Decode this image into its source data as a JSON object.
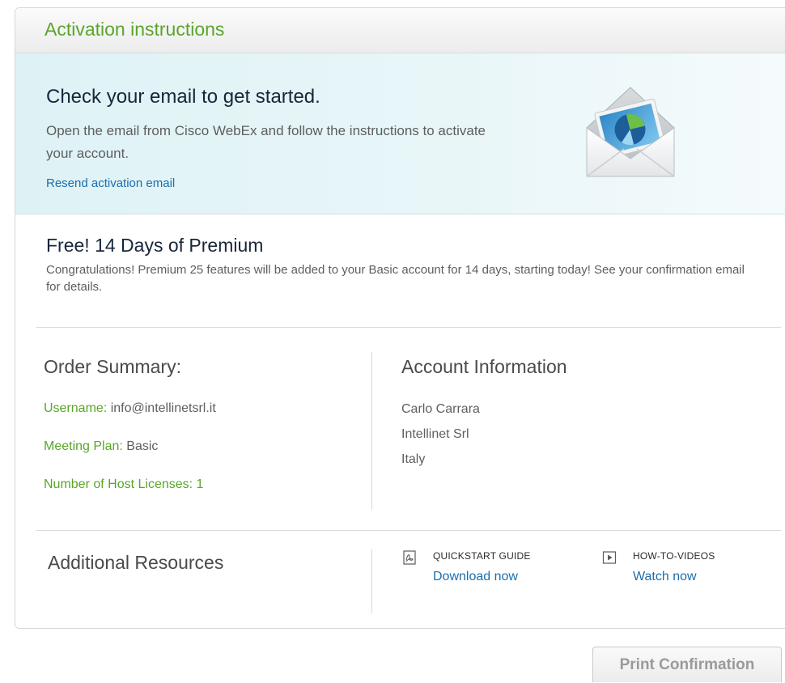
{
  "panel": {
    "title": "Activation instructions"
  },
  "activation": {
    "headline": "Check your email to get started.",
    "description": "Open the email from Cisco WebEx and follow the instructions to activate your account.",
    "resend_link": "Resend activation email",
    "icon": "envelope-icon"
  },
  "premium": {
    "title": "Free! 14 Days of Premium",
    "text": "Congratulations! Premium 25 features will be added to your Basic account for 14 days, starting today! See your confirmation email for details."
  },
  "order_summary": {
    "title": "Order Summary:",
    "username_label": "Username:",
    "username_value": "info@intellinetsrl.it",
    "plan_label": "Meeting Plan:",
    "plan_value": "Basic",
    "licenses_label": "Number of Host Licenses:",
    "licenses_value": "1"
  },
  "account_info": {
    "title": "Account Information",
    "name": "Carlo Carrara",
    "company": "Intellinet Srl",
    "country": "Italy"
  },
  "resources": {
    "title": "Additional Resources",
    "quickstart_label": "QUICKSTART GUIDE",
    "quickstart_link": "Download now",
    "quickstart_icon": "pdf-document-icon",
    "videos_label": "HOW-TO-VIDEOS",
    "videos_link": "Watch now",
    "videos_icon": "play-icon"
  },
  "actions": {
    "print_label": "Print Confirmation"
  },
  "colors": {
    "accent_green": "#5aa52b",
    "link_blue": "#1b6eae",
    "banner_bg": "#def2f5"
  }
}
